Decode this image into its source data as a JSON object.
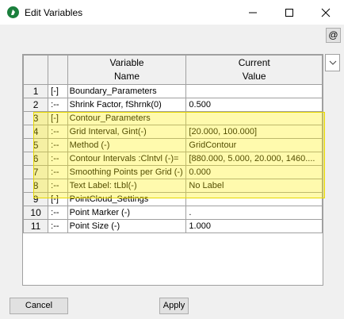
{
  "window": {
    "title": "Edit Variables"
  },
  "toolbar": {
    "at_label": "@"
  },
  "grid": {
    "headers": {
      "variable": "Variable\nName",
      "value": "Current\nValue"
    },
    "rows": [
      {
        "num": "1",
        "toggle": "[-]",
        "name": "Boundary_Parameters",
        "value": ""
      },
      {
        "num": "2",
        "toggle": ":--",
        "name": "Shrink Factor, fShrnk(0)",
        "value": "0.500"
      },
      {
        "num": "3",
        "toggle": "[-]",
        "name": "Contour_Parameters",
        "value": ""
      },
      {
        "num": "4",
        "toggle": ":--",
        "name": "Grid Interval, Gint(-)",
        "value": "[20.000, 100.000]"
      },
      {
        "num": "5",
        "toggle": ":--",
        "name": "Method (-)",
        "value": "GridContour"
      },
      {
        "num": "6",
        "toggle": ":--",
        "name": "Contour Intervals :Clntvl (-)=",
        "value": "[880.000, 5.000, 20.000, 1460...."
      },
      {
        "num": "7",
        "toggle": ":--",
        "name": "Smoothing Points per Grid (-)",
        "value": "0.000"
      },
      {
        "num": "8",
        "toggle": ":--",
        "name": "Text Label: tLbl(-)",
        "value": "No Label"
      },
      {
        "num": "9",
        "toggle": "[-]",
        "name": "PointCloud_Settings",
        "value": ""
      },
      {
        "num": "10",
        "toggle": ":--",
        "name": "Point Marker (-)",
        "value": "."
      },
      {
        "num": "11",
        "toggle": ":--",
        "name": "Point Size (-)",
        "value": "1.000"
      }
    ]
  },
  "buttons": {
    "cancel": "Cancel",
    "apply": "Apply"
  }
}
